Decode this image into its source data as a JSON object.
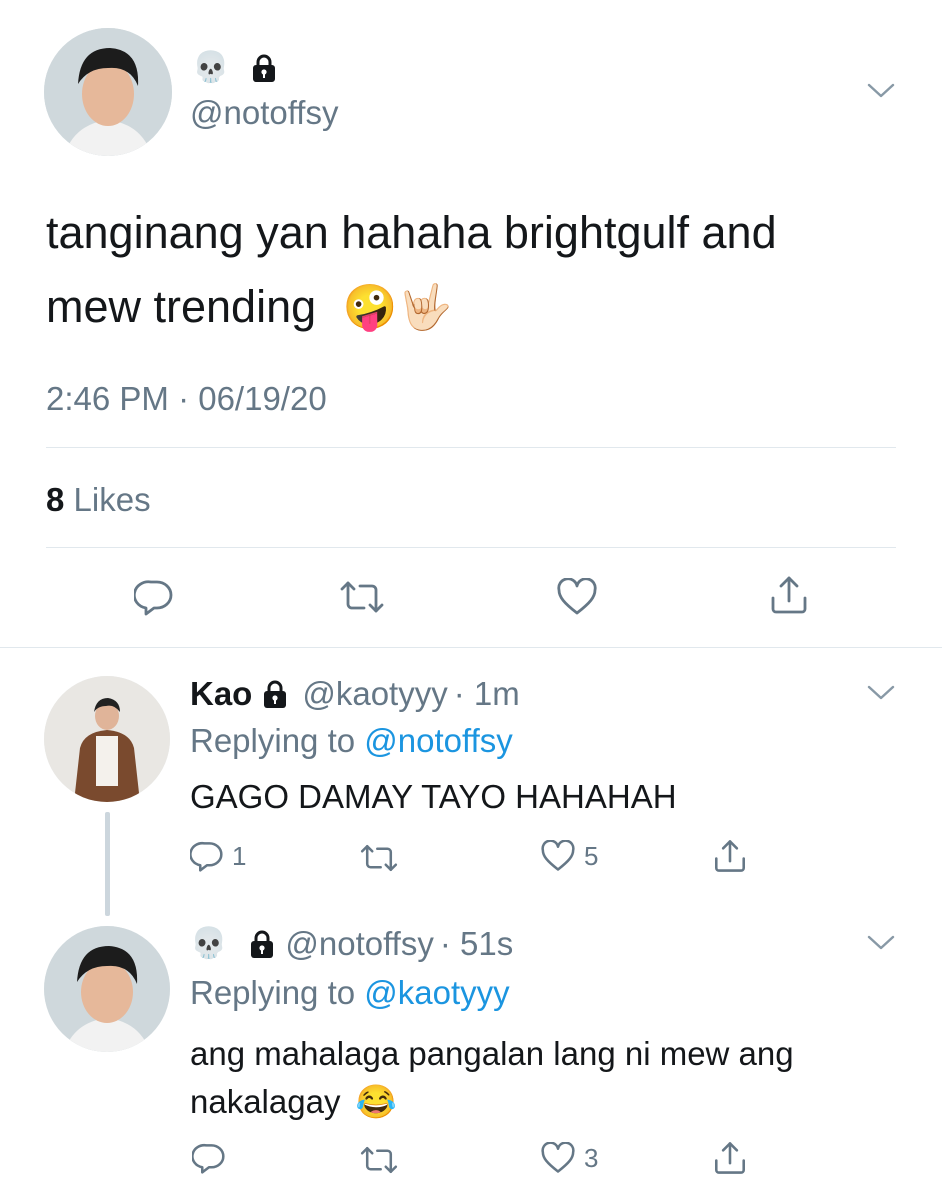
{
  "main_tweet": {
    "name_emoji": "💀",
    "handle": "@notoffsy",
    "text_line1": "tanginang yan hahaha brightgulf and",
    "text_line2": "mew trending",
    "text_emojis": "🤪🤟🏻",
    "timestamp": "2:46 PM · 06/19/20",
    "likes_count": "8",
    "likes_label": "Likes"
  },
  "reply1": {
    "name": "Kao",
    "handle": "@kaotyyy",
    "time": "· 1m",
    "replying_prefix": "Replying to",
    "replying_handle": "@notoffsy",
    "text": "GAGO DAMAY TAYO HAHAHAH",
    "reply_count": "1",
    "like_count": "5"
  },
  "reply2": {
    "name_emoji": "💀",
    "handle": "@notoffsy",
    "time": "· 51s",
    "replying_prefix": "Replying to",
    "replying_handle": "@kaotyyy",
    "text_line1": "ang mahalaga pangalan lang ni mew ang",
    "text_line2": "nakalagay",
    "text_emoji": "😂",
    "like_count": "3"
  },
  "colors": {
    "text": "#14171a",
    "muted": "#657786",
    "link": "#1b95e0",
    "divider": "#e1e8ed",
    "icon": "#657786"
  },
  "icons": [
    "chevron-down-icon",
    "lock-icon",
    "reply-icon",
    "retweet-icon",
    "like-icon",
    "share-icon"
  ]
}
